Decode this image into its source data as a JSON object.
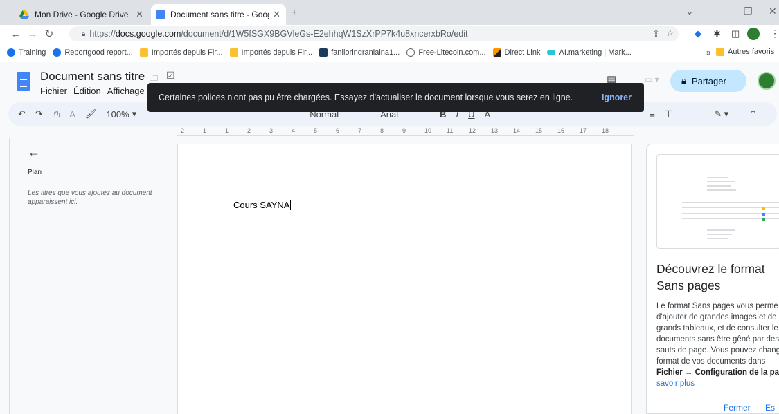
{
  "browser": {
    "tabs": [
      {
        "title": "Mon Drive - Google Drive",
        "icon": "google-drive-icon"
      },
      {
        "title": "Document sans titre - Google Do",
        "icon": "google-docs-icon"
      }
    ],
    "url_prefix": "https://",
    "url_host": "docs.google.com",
    "url_path": "/document/d/1W5fSGX9BGVleGs-E2ehhqW1SzXrPP7k4u8xncerxbRo/edit",
    "bookmarks": [
      "Training",
      "Reportgood report...",
      "Importés depuis Fir...",
      "Importés depuis Fir...",
      "fanilorindraniaina1...",
      "Free-Litecoin.com...",
      "Direct Link",
      "AI.marketing | Mark..."
    ],
    "more_bookmarks": "»",
    "other_bookmarks": "Autres favoris"
  },
  "doc": {
    "title": "Document sans titre",
    "menus": [
      "Fichier",
      "Édition",
      "Affichage"
    ],
    "share_label": "Partager",
    "zoom": "100%",
    "style_value": "Normal",
    "font_value": "Arial",
    "text": "Cours SAYNA"
  },
  "toast": {
    "message": "Certaines polices n'ont pas pu être chargées. Essayez d'actualiser le document lorsque vous serez en ligne.",
    "action": "Ignorer"
  },
  "ruler": {
    "labels": [
      "2",
      "1",
      "1",
      "2",
      "3",
      "4",
      "5",
      "6",
      "7",
      "8",
      "9",
      "10",
      "11",
      "12",
      "13",
      "14",
      "15",
      "16",
      "17",
      "18"
    ]
  },
  "outline": {
    "title": "Plan",
    "hint": "Les titres que vous ajoutez au document apparaissent ici."
  },
  "side_panel": {
    "title": "Découvrez le format Sans pages",
    "body_lines": [
      "Le format Sans pages vous perme",
      "d'ajouter de grandes images et de",
      "grands tableaux, et de consulter le",
      "documents sans être gêné par des",
      "sauts de page. Vous pouvez chang",
      "format de vos documents dans"
    ],
    "body_bold": "Fichier → Configuration de la page",
    "link": "savoir plus",
    "close": "Fermer",
    "try": "Es"
  },
  "colors": {
    "accent": "#1a73e8",
    "share_bg": "#c2e7ff",
    "toolbar_bg": "#edf2fa",
    "docs_blue": "#4285f4"
  }
}
